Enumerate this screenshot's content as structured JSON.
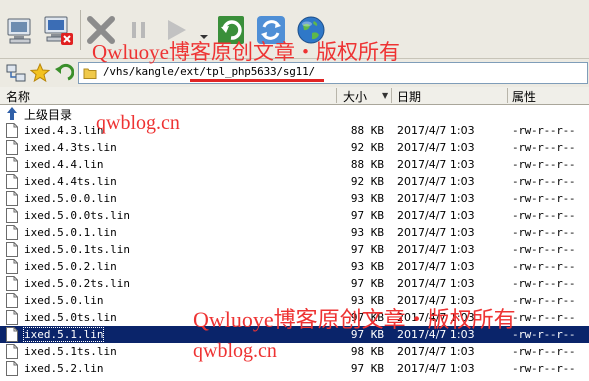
{
  "toolbar": {
    "buttons": [
      "computer-icon",
      "disconnect-icon",
      "stop-icon",
      "pause-icon",
      "play-icon",
      "refresh-icon",
      "sync-icon",
      "globe-icon"
    ]
  },
  "address": {
    "path": "/vhs/kangle/ext/tpl_php5633/sg11/"
  },
  "columns": {
    "name": "名称",
    "size": "大小",
    "date": "日期",
    "perm": "属性"
  },
  "parent_label": "上级目录",
  "files": [
    {
      "name": "ixed.4.3.lin",
      "size": "88 KB",
      "date": "2017/4/7 1:03",
      "perm": "-rw-r--r--"
    },
    {
      "name": "ixed.4.3ts.lin",
      "size": "92 KB",
      "date": "2017/4/7 1:03",
      "perm": "-rw-r--r--"
    },
    {
      "name": "ixed.4.4.lin",
      "size": "88 KB",
      "date": "2017/4/7 1:03",
      "perm": "-rw-r--r--"
    },
    {
      "name": "ixed.4.4ts.lin",
      "size": "92 KB",
      "date": "2017/4/7 1:03",
      "perm": "-rw-r--r--"
    },
    {
      "name": "ixed.5.0.0.lin",
      "size": "93 KB",
      "date": "2017/4/7 1:03",
      "perm": "-rw-r--r--"
    },
    {
      "name": "ixed.5.0.0ts.lin",
      "size": "97 KB",
      "date": "2017/4/7 1:03",
      "perm": "-rw-r--r--"
    },
    {
      "name": "ixed.5.0.1.lin",
      "size": "93 KB",
      "date": "2017/4/7 1:03",
      "perm": "-rw-r--r--"
    },
    {
      "name": "ixed.5.0.1ts.lin",
      "size": "97 KB",
      "date": "2017/4/7 1:03",
      "perm": "-rw-r--r--"
    },
    {
      "name": "ixed.5.0.2.lin",
      "size": "93 KB",
      "date": "2017/4/7 1:03",
      "perm": "-rw-r--r--"
    },
    {
      "name": "ixed.5.0.2ts.lin",
      "size": "97 KB",
      "date": "2017/4/7 1:03",
      "perm": "-rw-r--r--"
    },
    {
      "name": "ixed.5.0.lin",
      "size": "93 KB",
      "date": "2017/4/7 1:03",
      "perm": "-rw-r--r--"
    },
    {
      "name": "ixed.5.0ts.lin",
      "size": "97 KB",
      "date": "2017/4/7 1:03",
      "perm": "-rw-r--r--"
    },
    {
      "name": "ixed.5.1.lin",
      "size": "97 KB",
      "date": "2017/4/7 1:03",
      "perm": "-rw-r--r--",
      "selected": true
    },
    {
      "name": "ixed.5.1ts.lin",
      "size": "98 KB",
      "date": "2017/4/7 1:03",
      "perm": "-rw-r--r--"
    },
    {
      "name": "ixed.5.2.lin",
      "size": "97 KB",
      "date": "2017/4/7 1:03",
      "perm": "-rw-r--r--"
    }
  ],
  "watermarks": {
    "top": "Qwluoye博客原创文章・版权所有",
    "site_top": "qwblog.cn",
    "bottom": "Qwluoye博客原创文章・版权所有",
    "site_bottom": "qwblog.cn"
  },
  "colors": {
    "selection": "#0a246a",
    "watermark": "#e33333",
    "toolbar_bg": "#eceae2"
  }
}
